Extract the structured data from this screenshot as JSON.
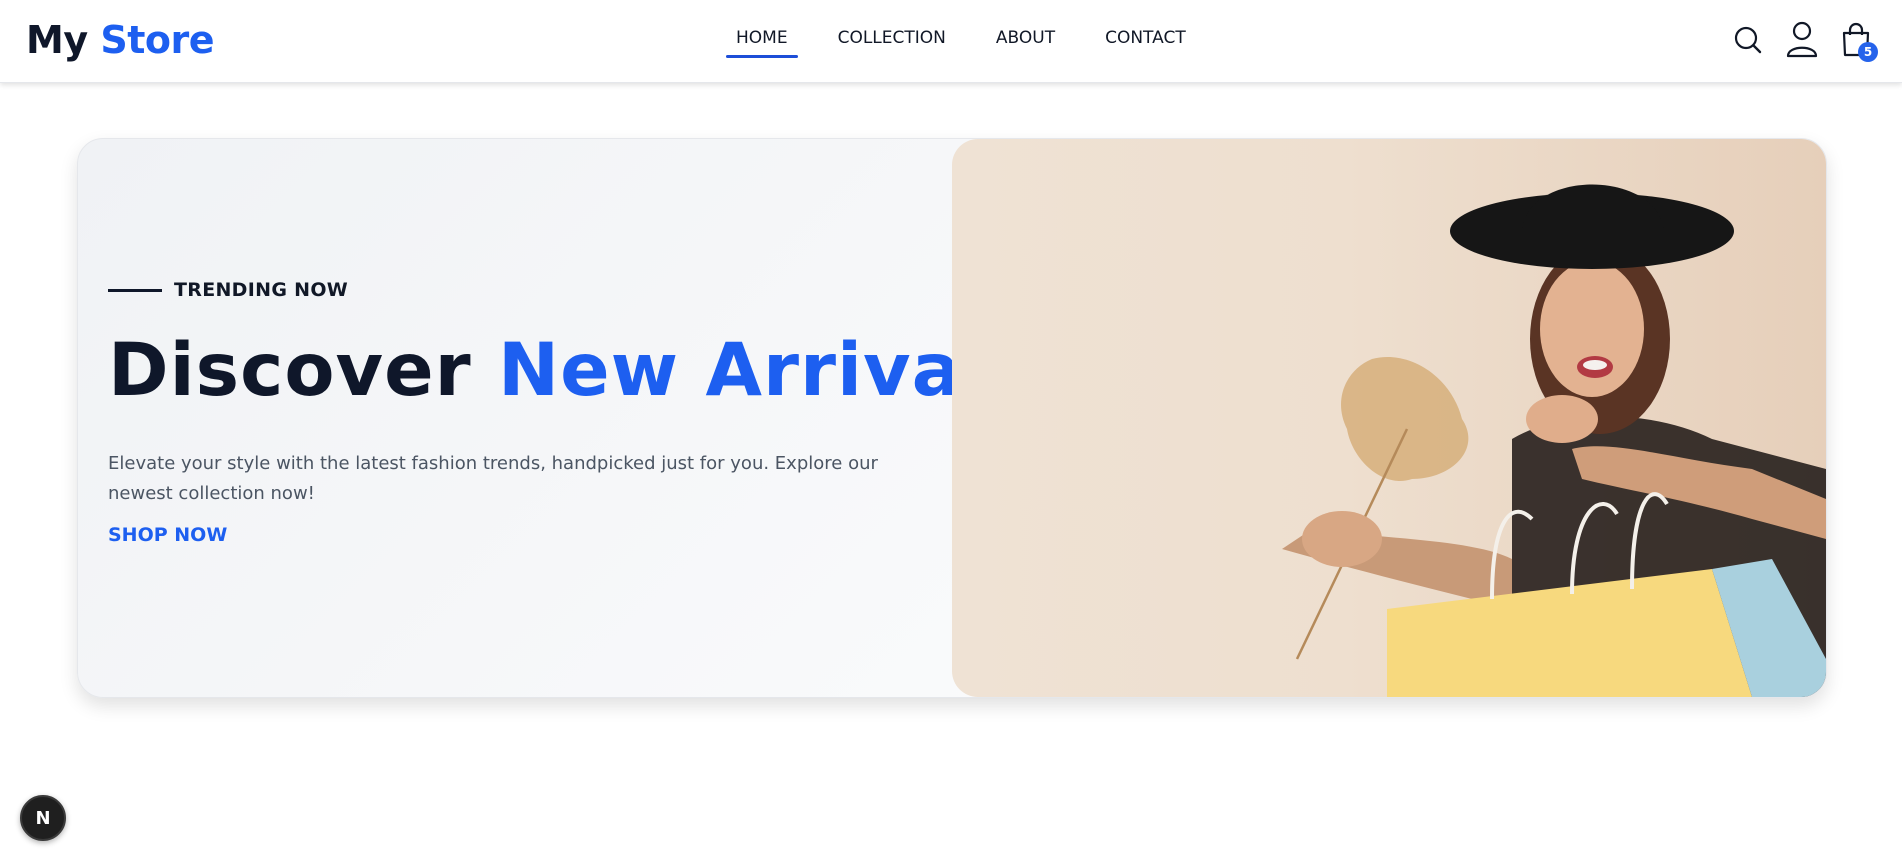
{
  "brand": {
    "first": "My",
    "second": "Store"
  },
  "nav": {
    "items": [
      {
        "label": "HOME",
        "active": true
      },
      {
        "label": "COLLECTION",
        "active": false
      },
      {
        "label": "ABOUT",
        "active": false
      },
      {
        "label": "CONTACT",
        "active": false
      }
    ]
  },
  "header_icons": {
    "search": "search-icon",
    "account": "user-icon",
    "cart": "shopping-bag-icon",
    "cart_count": "5"
  },
  "hero": {
    "tag": "TRENDING NOW",
    "headline_part1": "Discover",
    "headline_part2": "New Arrivals",
    "description": "Elevate your style with the latest fashion trends, handpicked just for you. Explore our newest collection now!",
    "cta_label": "SHOP NOW"
  },
  "dev_badge": {
    "letter": "N"
  },
  "colors": {
    "accent": "#1d5ff0",
    "dark": "#0f172a",
    "text_muted": "#4b5563",
    "badge": "#2563eb"
  }
}
